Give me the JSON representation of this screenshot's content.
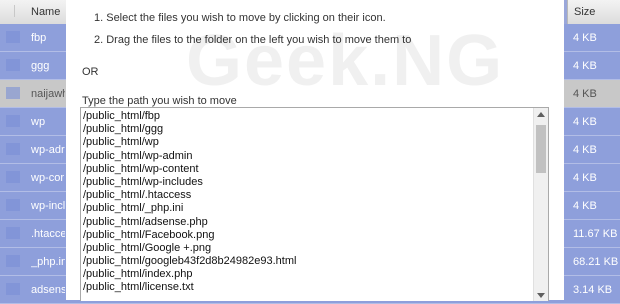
{
  "table": {
    "header_name": "Name",
    "header_size": "Size",
    "rows": [
      {
        "name": "fbp",
        "size": "4 KB"
      },
      {
        "name": "ggg",
        "size": "4 KB"
      },
      {
        "name": "naijawh",
        "size": "4 KB"
      },
      {
        "name": "wp",
        "size": "4 KB"
      },
      {
        "name": "wp-adr",
        "size": "4 KB"
      },
      {
        "name": "wp-cor",
        "size": "4 KB"
      },
      {
        "name": "wp-incl",
        "size": "4 KB"
      },
      {
        "name": ".htacce",
        "size": "11.67 KB"
      },
      {
        "name": "_php.in",
        "size": "68.21 KB"
      },
      {
        "name": "adsens",
        "size": "3.14 KB"
      },
      {
        "name": "",
        "size": ""
      }
    ]
  },
  "dialog": {
    "watermark": "Geek.NG",
    "instructions": [
      "1. Select the files you wish to move by clicking on their icon.",
      "2. Drag the files to the folder on the left you wish to move them to"
    ],
    "or_label": "OR",
    "path_label": "Type the path you wish to move",
    "paths": [
      "/public_html/fbp",
      "/public_html/ggg",
      "/public_html/wp",
      "/public_html/wp-admin",
      "/public_html/wp-content",
      "/public_html/wp-includes",
      "/public_html/.htaccess",
      "/public_html/_php.ini",
      "/public_html/adsense.php",
      "/public_html/Facebook.png",
      "/public_html/Google +.png",
      "/public_html/googleb43f2d8b24982e93.html",
      "/public_html/index.php",
      "/public_html/license.txt"
    ]
  }
}
